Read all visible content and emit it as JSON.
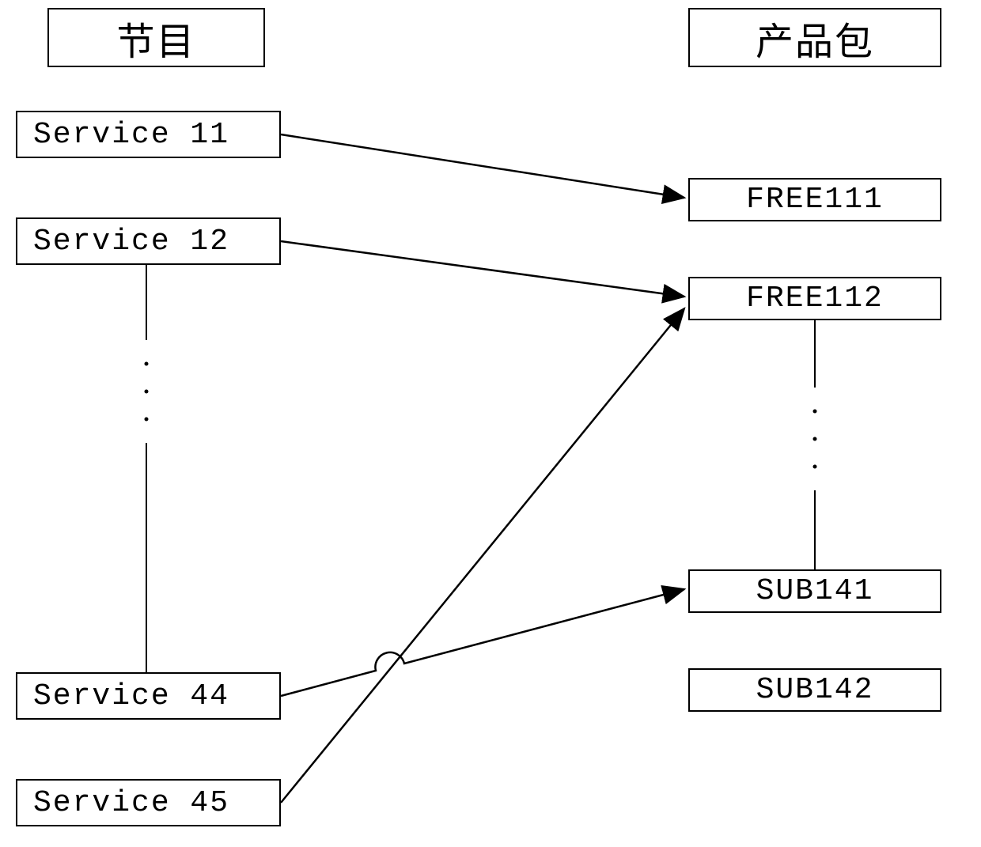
{
  "headers": {
    "left": "节目",
    "right": "产品包"
  },
  "services": [
    {
      "label": "Service 11"
    },
    {
      "label": "Service 12"
    },
    {
      "label": "Service 44"
    },
    {
      "label": "Service 45"
    }
  ],
  "packages": [
    {
      "label": "FREE111"
    },
    {
      "label": "FREE112"
    },
    {
      "label": "SUB141"
    },
    {
      "label": "SUB142"
    }
  ],
  "connections": [
    {
      "from": "Service 11",
      "to": "FREE111"
    },
    {
      "from": "Service 12",
      "to": "FREE112"
    },
    {
      "from": "Service 44",
      "to": "SUB141"
    },
    {
      "from": "Service 45",
      "to": "FREE112"
    }
  ],
  "ellipsis_between": {
    "services": [
      "Service 12",
      "Service 44"
    ],
    "packages": [
      "FREE112",
      "SUB141"
    ]
  }
}
